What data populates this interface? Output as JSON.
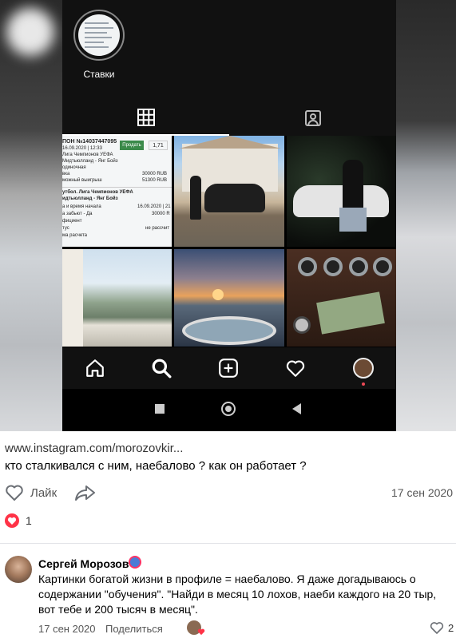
{
  "instagram": {
    "highlight_label": "Ставки",
    "ticket": {
      "number": "ПОН №14037447095",
      "date": "16.09.2020 | 12:33",
      "sell_label": "Продать",
      "odds": "1,71",
      "league": "Лига Чемпионов УЕФА",
      "match": "Мидтьюлланд - Янг Бойз",
      "kind": "одиночная",
      "stake_label": "вка",
      "stake_value": "30000 RUB",
      "win_label": "можный выигрыш",
      "win_value": "51300 RUB",
      "sport": "утбол. Лига Чемпионов УЕФА",
      "match2": "идтьюлланд - Янг Бойз",
      "start_label": "а и время начала",
      "start_value": "16.09.2020 | 21",
      "bet_label": "а забьют - Да",
      "bet_value": "30000 R",
      "coef_label": "фициент",
      "status_label": "тус",
      "status_value": "не рассчит",
      "calc_label": "ма расчета"
    }
  },
  "post": {
    "link": "www.instagram.com/morozovkir...",
    "text": "кто сталкивался с ним, наебалово ? как он работает ?",
    "like_label": "Лайк",
    "date": "17 сен 2020",
    "likes_count": "1"
  },
  "comment": {
    "author": "Сергей Морозов",
    "text": "Картинки богатой жизни в профиле = наебалово. Я даже догадываюсь о содержании \"обучения\". \"Найди в месяц 10 лохов, наеби каждого на 20 тыр, вот тебе и 200 тысяч в месяц\".",
    "date": "17 сен 2020",
    "reply_label": "Поделиться",
    "likes_count": "2"
  },
  "colors": {
    "like_red": "#ff3347",
    "instagram_bg": "#000000",
    "sell_green": "#3b8a4a"
  }
}
